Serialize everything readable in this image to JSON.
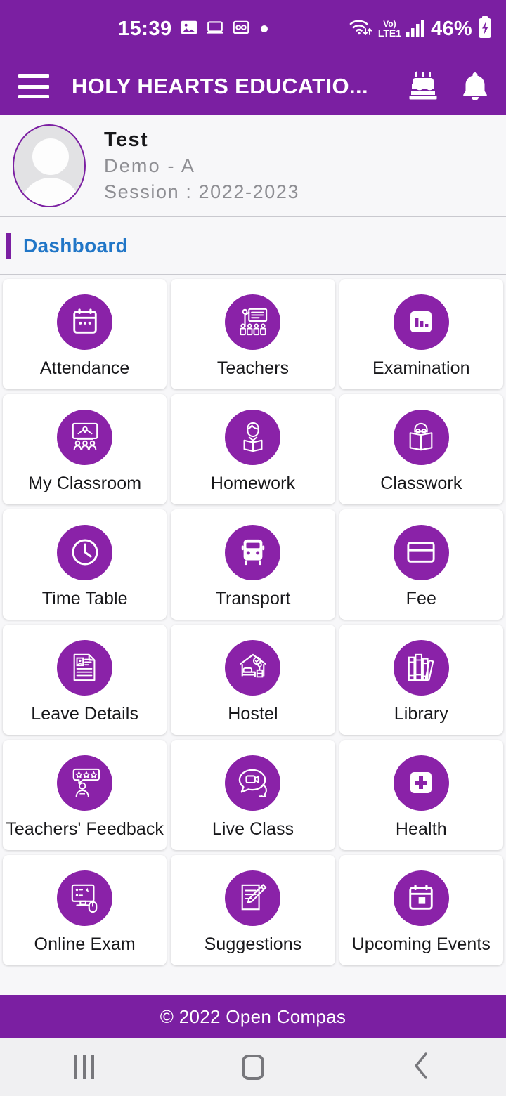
{
  "status_bar": {
    "time": "15:39",
    "icons_left": [
      "image-icon",
      "laptop-icon",
      "voicemail-icon",
      "dot-indicator-icon"
    ],
    "network": "LTE1",
    "volte_label_top": "Vo)",
    "volte_label_bottom": "LTE1",
    "battery_percent": "46%",
    "icons_right": [
      "wifi-icon",
      "volte-icon",
      "signal-bars-icon",
      "battery-charging-icon"
    ]
  },
  "app_bar": {
    "menu_icon": "hamburger-menu-icon",
    "title": "HOLY HEARTS EDUCATIO...",
    "actions": [
      {
        "name": "birthday-cake-icon",
        "label": "Birthdays"
      },
      {
        "name": "notification-bell-icon",
        "label": "Notifications"
      }
    ]
  },
  "profile": {
    "avatar_icon": "default-user-avatar",
    "name": "Test",
    "class": "Demo - A",
    "session": "Session : 2022-2023"
  },
  "dashboard": {
    "title": "Dashboard"
  },
  "tiles": [
    {
      "label": "Attendance",
      "icon": "calendar-icon"
    },
    {
      "label": "Teachers",
      "icon": "teacher-board-icon"
    },
    {
      "label": "Examination",
      "icon": "bar-chart-icon"
    },
    {
      "label": "My Classroom",
      "icon": "classroom-icon"
    },
    {
      "label": "Homework",
      "icon": "student-reading-icon"
    },
    {
      "label": "Classwork",
      "icon": "open-book-reader-icon"
    },
    {
      "label": "Time Table",
      "icon": "clock-icon"
    },
    {
      "label": "Transport",
      "icon": "bus-icon"
    },
    {
      "label": "Fee",
      "icon": "credit-card-icon"
    },
    {
      "label": "Leave Details",
      "icon": "document-id-icon"
    },
    {
      "label": "Hostel",
      "icon": "hostel-bed-icon"
    },
    {
      "label": "Library",
      "icon": "books-icon"
    },
    {
      "label": "Teachers' Feedback",
      "icon": "star-feedback-icon"
    },
    {
      "label": "Live Class",
      "icon": "video-chat-icon"
    },
    {
      "label": "Health",
      "icon": "medical-cross-icon"
    },
    {
      "label": "Online Exam",
      "icon": "computer-mouse-icon"
    },
    {
      "label": "Suggestions",
      "icon": "notepad-pencil-icon"
    },
    {
      "label": "Upcoming Events",
      "icon": "calendar-event-icon"
    }
  ],
  "footer": {
    "copyright": "© 2022 Open Compas"
  },
  "nav_bar": {
    "recents_label": "Recents",
    "home_label": "Home",
    "back_label": "Back"
  },
  "colors": {
    "brand_purple": "#7B1FA2",
    "icon_purple": "#8A22A8",
    "accent_blue": "#2176C7",
    "page_bg": "#f7f7f9",
    "card_bg": "#ffffff",
    "muted_text": "#8e8e93"
  }
}
